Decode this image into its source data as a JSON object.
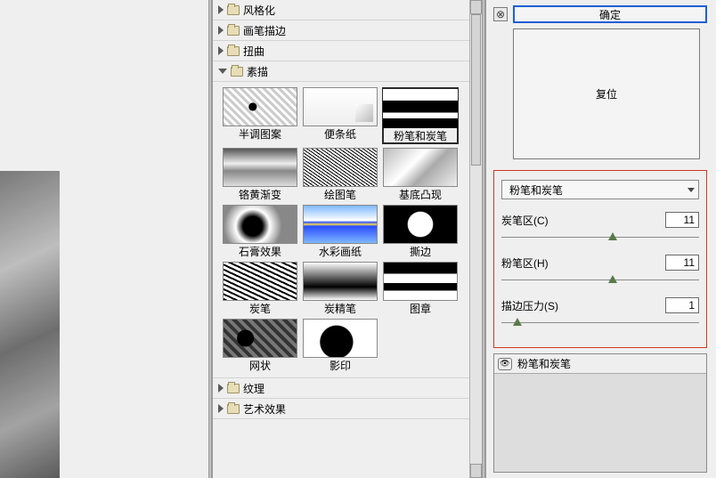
{
  "categories": {
    "stylize": "风格化",
    "brush": "画笔描边",
    "distort": "扭曲",
    "sketch": "素描",
    "texture": "纹理",
    "artistic": "艺术效果"
  },
  "sketch_filters": [
    {
      "key": "halftone",
      "label": "半调图案",
      "cls": "f-halftone"
    },
    {
      "key": "notepaper",
      "label": "便条纸",
      "cls": "f-note"
    },
    {
      "key": "chalk_charcoal",
      "label": "粉笔和炭笔",
      "cls": "f-chalk",
      "selected": true
    },
    {
      "key": "chrome",
      "label": "铬黄渐变",
      "cls": "f-chrome"
    },
    {
      "key": "graphic_pen",
      "label": "绘图笔",
      "cls": "f-graphic"
    },
    {
      "key": "bas_relief",
      "label": "基底凸现",
      "cls": "f-bas"
    },
    {
      "key": "plaster",
      "label": "石膏效果",
      "cls": "f-plaster"
    },
    {
      "key": "water_paper",
      "label": "水彩画纸",
      "cls": "f-water"
    },
    {
      "key": "torn_edges",
      "label": "撕边",
      "cls": "f-torn"
    },
    {
      "key": "charcoal",
      "label": "炭笔",
      "cls": "f-charcoal"
    },
    {
      "key": "conte",
      "label": "炭精笔",
      "cls": "f-conte"
    },
    {
      "key": "stamp",
      "label": "图章",
      "cls": "f-stamp"
    },
    {
      "key": "reticulation",
      "label": "网状",
      "cls": "f-retic"
    },
    {
      "key": "photocopy",
      "label": "影印",
      "cls": "f-photo"
    }
  ],
  "buttons": {
    "ok": "确定",
    "reset": "复位"
  },
  "controls": {
    "filter_name": "粉笔和炭笔",
    "param1": {
      "label": "炭笔区(C)",
      "value": "11",
      "thumb_pct": 54
    },
    "param2": {
      "label": "粉笔区(H)",
      "value": "11",
      "thumb_pct": 54
    },
    "param3": {
      "label": "描边压力(S)",
      "value": "1",
      "thumb_pct": 6
    }
  },
  "layers": {
    "title": "粉笔和炭笔"
  },
  "icons": {
    "expand": "⊗"
  }
}
